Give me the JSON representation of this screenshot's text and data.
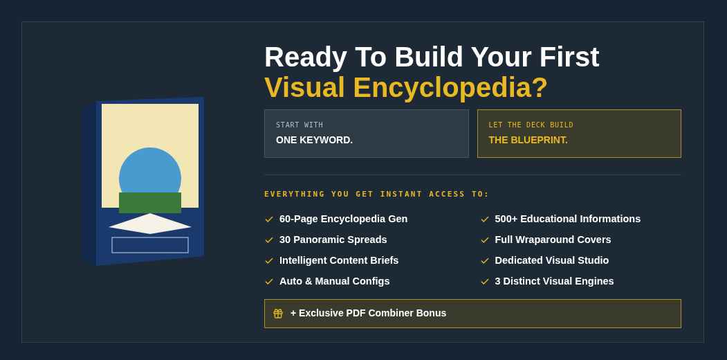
{
  "heading": {
    "line_1": "Ready To Build Your First",
    "line_2": "Visual Encyclopedia?"
  },
  "steps": [
    {
      "label": "START WITH",
      "value": "ONE KEYWORD.",
      "highlighted": false
    },
    {
      "label": "LET THE DECK BUILD",
      "value": "THE BLUEPRINT.",
      "highlighted": true
    }
  ],
  "features_title": "EVERYTHING YOU GET INSTANT ACCESS TO:",
  "features": [
    "60-Page Encyclopedia Gen",
    "500+ Educational Informations",
    "30 Panoramic Spreads",
    "Full Wraparound Covers",
    "Intelligent Content Briefs",
    "Dedicated Visual Studio",
    "Auto & Manual Configs",
    "3 Distinct Visual Engines"
  ],
  "bonus": "+ Exclusive PDF Combiner Bonus"
}
